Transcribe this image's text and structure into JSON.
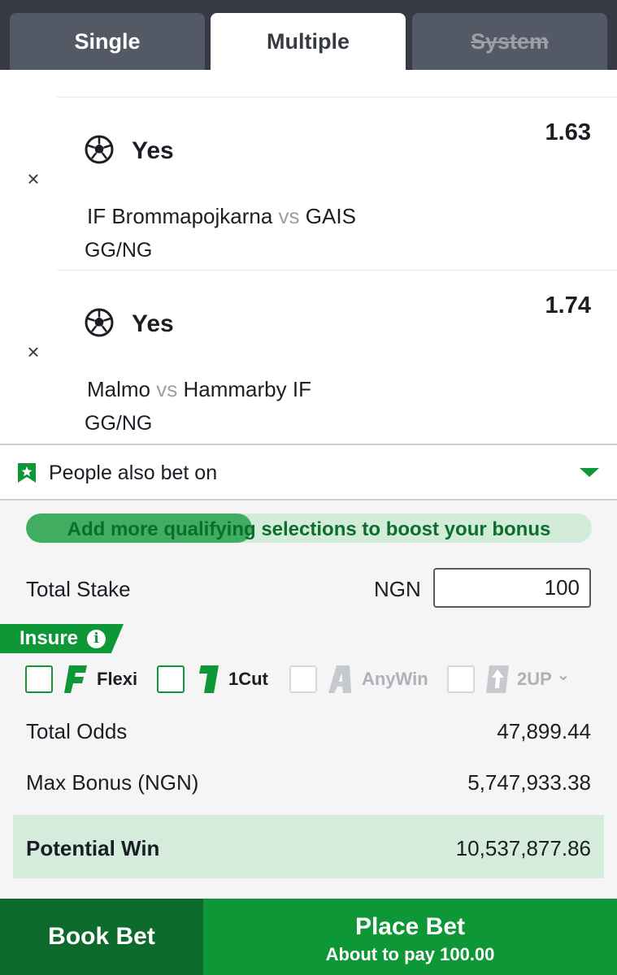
{
  "tabs": [
    "Single",
    "Multiple",
    "System"
  ],
  "selections": [
    {
      "pick": "Yes",
      "odds": "1.63",
      "home": "IF Brommapojkarna",
      "vs": "vs",
      "away": "GAIS",
      "market": "GG/NG",
      "sport_icon": "soccer-ball-icon"
    },
    {
      "pick": "Yes",
      "odds": "1.74",
      "home": "Malmo",
      "vs": "vs",
      "away": "Hammarby IF",
      "market": "GG/NG",
      "sport_icon": "soccer-ball-icon"
    }
  ],
  "close_glyph": "×",
  "people_also_bet_on": "People also bet on",
  "bonus": {
    "text": "Add more qualifying selections to boost your bonus",
    "progress": 0.4
  },
  "stake": {
    "label": "Total Stake",
    "currency": "NGN",
    "value": "100"
  },
  "insure": {
    "label": "Insure",
    "info": "i"
  },
  "insure_options": [
    {
      "name": "Flexi",
      "letter": "F",
      "enabled": true
    },
    {
      "name": "1Cut",
      "letter": "1",
      "enabled": true
    },
    {
      "name": "AnyWin",
      "letter": "A",
      "enabled": false
    },
    {
      "name": "2UP",
      "letter": "↑",
      "enabled": false
    }
  ],
  "chevron": "⌄",
  "summary": {
    "total_odds_label": "Total Odds",
    "total_odds": "47,899.44",
    "max_bonus_label": "Max Bonus (NGN)",
    "max_bonus": "5,747,933.38",
    "potential_win_label": "Potential Win",
    "potential_win": "10,537,877.86"
  },
  "actions": {
    "book_bet": "Book Bet",
    "place_bet": "Place Bet",
    "pay_text": "About to pay 100.00"
  },
  "colors": {
    "brand_green": "#0d9737",
    "dark_green": "#0c6a2a",
    "tab_bg": "#353a45"
  }
}
